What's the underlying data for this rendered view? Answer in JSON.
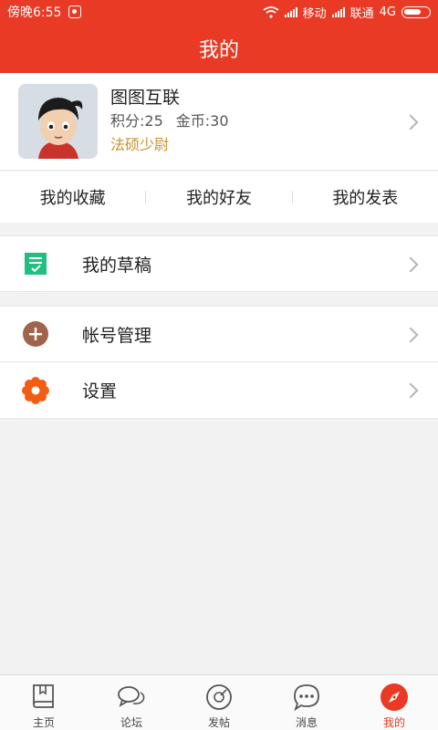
{
  "status_bar": {
    "time": "傍晚6:55",
    "carrier1": "移动",
    "carrier2": "联通",
    "network": "4G"
  },
  "header": {
    "title": "我的"
  },
  "profile": {
    "name": "图图互联",
    "points": "积分:25",
    "coins": "金币:30",
    "rank": "法硕少尉"
  },
  "quick_links": [
    {
      "label": "我的收藏"
    },
    {
      "label": "我的好友"
    },
    {
      "label": "我的发表"
    }
  ],
  "menu": [
    {
      "label": "我的草稿",
      "icon": "draft-icon",
      "color": "#1fbf7f"
    },
    {
      "label": "帐号管理",
      "icon": "add-circle-icon",
      "color": "#a0644c"
    },
    {
      "label": "设置",
      "icon": "settings-gear-icon",
      "color": "#f25c13"
    }
  ],
  "tabs": [
    {
      "label": "主页",
      "icon": "book-icon"
    },
    {
      "label": "论坛",
      "icon": "chat-bubbles-icon"
    },
    {
      "label": "发帖",
      "icon": "compose-disc-icon"
    },
    {
      "label": "消息",
      "icon": "message-dots-icon"
    },
    {
      "label": "我的",
      "icon": "compass-icon",
      "active": true
    }
  ],
  "colors": {
    "accent": "#e83a24",
    "rank": "#c9902e"
  }
}
